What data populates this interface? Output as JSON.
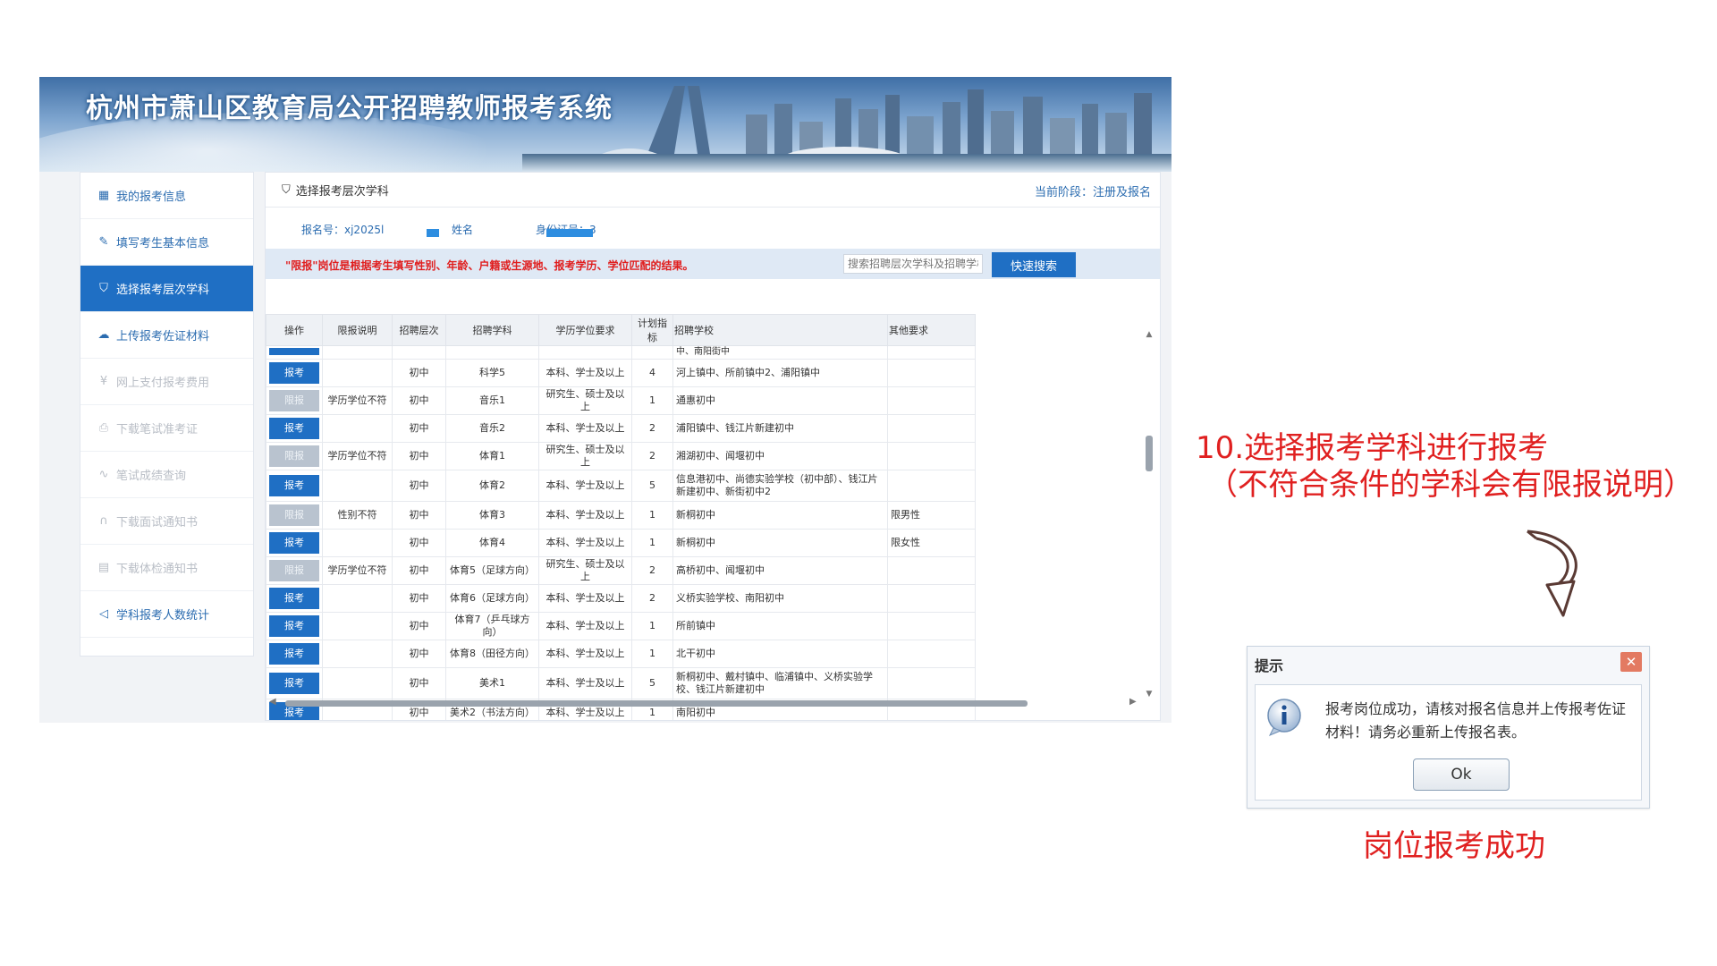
{
  "app": {
    "title": "杭州市萧山区教育局公开招聘教师报考系统"
  },
  "sidebar": {
    "items": [
      {
        "label": "我的报考信息",
        "icon": "grid-icon",
        "state": "normal"
      },
      {
        "label": "填写考生基本信息",
        "icon": "pencil-icon",
        "state": "normal"
      },
      {
        "label": "选择报考层次学科",
        "icon": "shield-check-icon",
        "state": "active"
      },
      {
        "label": "上传报考佐证材料",
        "icon": "cloud-upload-icon",
        "state": "normal"
      },
      {
        "label": "网上支付报考费用",
        "icon": "yen-icon",
        "state": "disabled"
      },
      {
        "label": "下载笔试准考证",
        "icon": "printer-icon",
        "state": "disabled"
      },
      {
        "label": "笔试成绩查询",
        "icon": "pulse-icon",
        "state": "disabled"
      },
      {
        "label": "下载面试通知书",
        "icon": "headset-icon",
        "state": "disabled"
      },
      {
        "label": "下载体检通知书",
        "icon": "document-icon",
        "state": "disabled"
      },
      {
        "label": "学科报考人数统计",
        "icon": "speaker-icon",
        "state": "normal"
      }
    ]
  },
  "panel": {
    "title": "选择报考层次学科",
    "stage": "当前阶段：注册及报名"
  },
  "info": {
    "reg_no": "报名号：xj2025l",
    "name_label": "姓名",
    "id_label": "身份证号：3"
  },
  "filter": {
    "note": "\"限报\"岗位是根据考生填写性别、年龄、户籍或生源地、报考学历、学位匹配的结果。",
    "search_placeholder": "搜索招聘层次学科及招聘学校",
    "search_button": "快速搜索"
  },
  "table": {
    "headers": [
      "操作",
      "限报说明",
      "招聘层次",
      "招聘学科",
      "学历学位要求",
      "计划指标",
      "招聘学校",
      "其他要求"
    ],
    "partial_top_school": "中、南阳街中",
    "rows": [
      {
        "action": "报考",
        "enabled": true,
        "restrict": "",
        "level": "初中",
        "subject": "科学5",
        "degree": "本科、学士及以上",
        "quota": "4",
        "schools": "河上镇中、所前镇中2、浦阳镇中",
        "other": "",
        "tall": false
      },
      {
        "action": "限报",
        "enabled": false,
        "restrict": "学历学位不符",
        "level": "初中",
        "subject": "音乐1",
        "degree": "研究生、硕士及以上",
        "quota": "1",
        "schools": "通惠初中",
        "other": "",
        "tall": false
      },
      {
        "action": "报考",
        "enabled": true,
        "restrict": "",
        "level": "初中",
        "subject": "音乐2",
        "degree": "本科、学士及以上",
        "quota": "2",
        "schools": "浦阳镇中、钱江片新建初中",
        "other": "",
        "tall": false
      },
      {
        "action": "限报",
        "enabled": false,
        "restrict": "学历学位不符",
        "level": "初中",
        "subject": "体育1",
        "degree": "研究生、硕士及以上",
        "quota": "2",
        "schools": "湘湖初中、闻堰初中",
        "other": "",
        "tall": false
      },
      {
        "action": "报考",
        "enabled": true,
        "restrict": "",
        "level": "初中",
        "subject": "体育2",
        "degree": "本科、学士及以上",
        "quota": "5",
        "schools": "信息港初中、尚德实验学校（初中部）、钱江片新建初中、新街初中2",
        "other": "",
        "tall": true
      },
      {
        "action": "限报",
        "enabled": false,
        "restrict": "性别不符",
        "level": "初中",
        "subject": "体育3",
        "degree": "本科、学士及以上",
        "quota": "1",
        "schools": "新桐初中",
        "other": "限男性",
        "tall": false
      },
      {
        "action": "报考",
        "enabled": true,
        "restrict": "",
        "level": "初中",
        "subject": "体育4",
        "degree": "本科、学士及以上",
        "quota": "1",
        "schools": "新桐初中",
        "other": "限女性",
        "tall": false
      },
      {
        "action": "限报",
        "enabled": false,
        "restrict": "学历学位不符",
        "level": "初中",
        "subject": "体育5（足球方向）",
        "degree": "研究生、硕士及以上",
        "quota": "2",
        "schools": "高桥初中、闻堰初中",
        "other": "",
        "tall": false
      },
      {
        "action": "报考",
        "enabled": true,
        "restrict": "",
        "level": "初中",
        "subject": "体育6（足球方向）",
        "degree": "本科、学士及以上",
        "quota": "2",
        "schools": "义桥实验学校、南阳初中",
        "other": "",
        "tall": false
      },
      {
        "action": "报考",
        "enabled": true,
        "restrict": "",
        "level": "初中",
        "subject": "体育7（乒乓球方向）",
        "degree": "本科、学士及以上",
        "quota": "1",
        "schools": "所前镇中",
        "other": "",
        "tall": false
      },
      {
        "action": "报考",
        "enabled": true,
        "restrict": "",
        "level": "初中",
        "subject": "体育8（田径方向）",
        "degree": "本科、学士及以上",
        "quota": "1",
        "schools": "北干初中",
        "other": "",
        "tall": false
      },
      {
        "action": "报考",
        "enabled": true,
        "restrict": "",
        "level": "初中",
        "subject": "美术1",
        "degree": "本科、学士及以上",
        "quota": "5",
        "schools": "新桐初中、戴村镇中、临浦镇中、义桥实验学校、钱江片新建初中",
        "other": "",
        "tall": true
      },
      {
        "action": "报考",
        "enabled": true,
        "restrict": "",
        "level": "初中",
        "subject": "美术2（书法方向）",
        "degree": "本科、学士及以上",
        "quota": "1",
        "schools": "南阳初中",
        "other": "",
        "tall": false
      }
    ]
  },
  "annotation": {
    "step": "10.选择报考学科进行报考",
    "hint": "（不符合条件的学科会有限报说明）",
    "result": "岗位报考成功"
  },
  "dialog": {
    "title": "提示",
    "message": "报考岗位成功，请核对报名信息并上传报考佐证材料！请务必重新上传报名表。",
    "ok": "Ok",
    "icon": "info-icon"
  },
  "colors": {
    "primary": "#1f6fc4",
    "alert": "#e01d1d",
    "annotation": "#e02020",
    "disabled": "#b9c3cf"
  }
}
